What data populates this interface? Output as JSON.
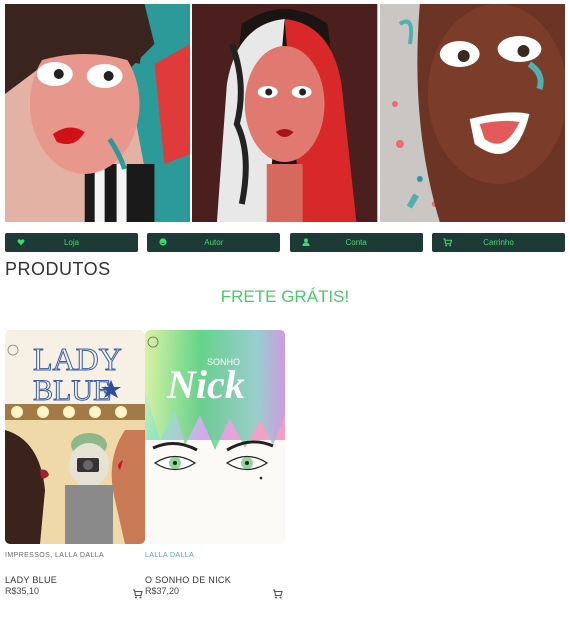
{
  "hero": {
    "panels": [
      "retrato-1",
      "retrato-2",
      "retrato-3"
    ]
  },
  "nav": {
    "items": [
      {
        "label": "Loja",
        "icon": "heart-icon"
      },
      {
        "label": "Autor",
        "icon": "smile-icon"
      },
      {
        "label": "Conta",
        "icon": "user-icon"
      },
      {
        "label": "Carrinho",
        "icon": "cart-icon"
      }
    ]
  },
  "page": {
    "title": "PRODUTOS",
    "promo": "FRETE GRÁTIS!"
  },
  "products": [
    {
      "cover_title": "LADY BLUE",
      "cover_title_line1": "LADY",
      "cover_title_line2": "BLUE",
      "category_1": "IMPRESSOS",
      "category_sep": ",",
      "category_2": "LALLA DALLA",
      "name": "LADY BLUE",
      "price": "R$35,10"
    },
    {
      "cover_title_small": "SONHO",
      "cover_title_big": "Nick",
      "category_1": "LALLA DALLA",
      "name": "O SONHO DE NICK",
      "price": "R$37,20"
    }
  ],
  "colors": {
    "nav_bg": "#1e3a36",
    "nav_text": "#3ddc6a",
    "promo": "#4cc96a"
  }
}
